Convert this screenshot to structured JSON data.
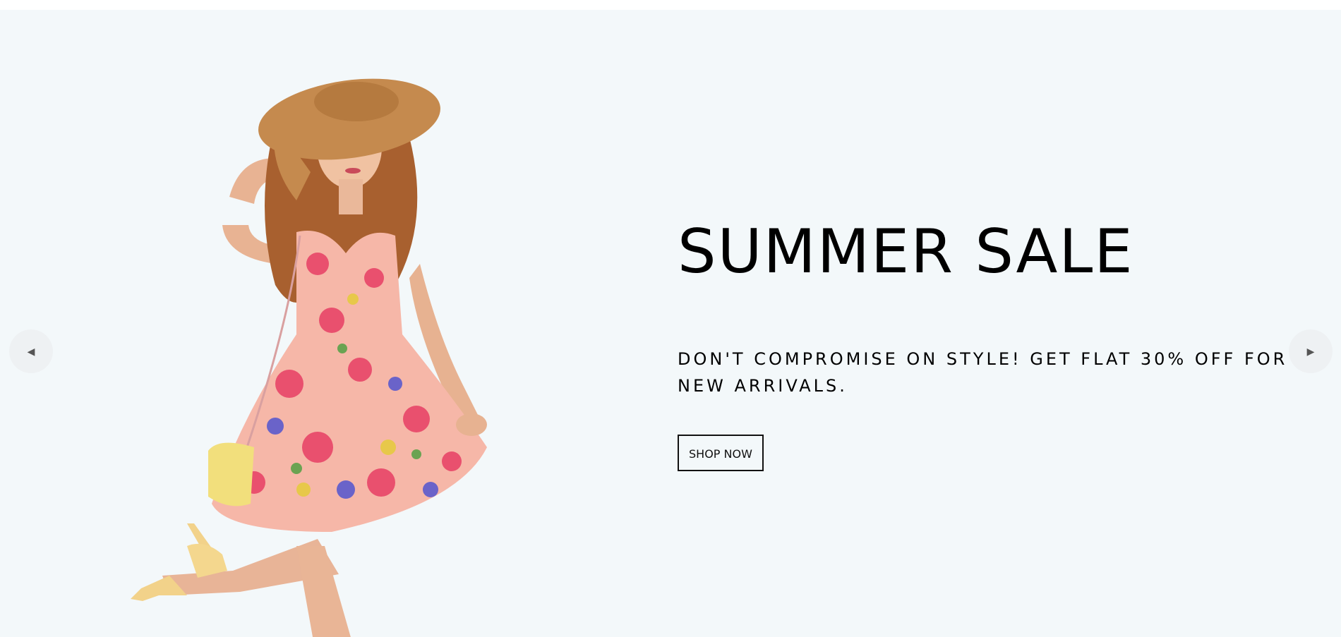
{
  "hero": {
    "title": "SUMMER SALE",
    "subtitle": "DON'T COMPROMISE ON STYLE! GET FLAT 30% OFF FOR NEW ARRIVALS.",
    "cta_label": "SHOP NOW",
    "background_color": "#f3f8fa"
  },
  "carousel": {
    "prev_icon": "◀",
    "next_icon": "▶"
  },
  "image": {
    "subject": "model-in-floral-dress"
  }
}
